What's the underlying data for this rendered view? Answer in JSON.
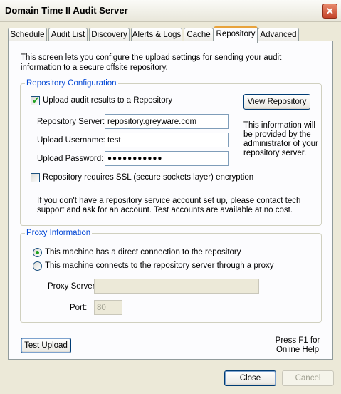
{
  "window": {
    "title": "Domain Time II Audit Server",
    "close_symbol": "✕"
  },
  "tabs": [
    {
      "label": "Schedule"
    },
    {
      "label": "Audit List"
    },
    {
      "label": "Discovery"
    },
    {
      "label": "Alerts & Logs"
    },
    {
      "label": "Cache"
    },
    {
      "label": "Repository",
      "active": true
    },
    {
      "label": "Advanced"
    }
  ],
  "intro_text": "This screen lets you configure the upload settings for sending your audit information to a secure offsite repository.",
  "repo_config": {
    "legend": "Repository Configuration",
    "upload_checkbox": {
      "label": "Upload audit results to a Repository",
      "checked": true
    },
    "view_button": "View Repository",
    "server_label": "Repository Server:",
    "server_value": "repository.greyware.com",
    "username_label": "Upload Username:",
    "username_value": "test",
    "password_label": "Upload Password:",
    "password_value": "●●●●●●●●●●●",
    "info_note": "This information will be provided by the administrator of your repository server.",
    "ssl_checkbox": {
      "label": "Repository requires SSL (secure sockets layer) encryption",
      "checked": false
    },
    "account_note": "If you don't have a repository service account set up, please contact tech support and ask for an account. Test accounts are available at no cost."
  },
  "proxy": {
    "legend": "Proxy Information",
    "direct_radio": {
      "label": "This machine has a direct connection to the repository",
      "selected": true
    },
    "proxy_radio": {
      "label": "This machine connects to the repository server through a proxy",
      "selected": false
    },
    "server_label": "Proxy Server:",
    "server_value": "",
    "port_label": "Port:",
    "port_value": "80"
  },
  "test_upload_button": "Test Upload",
  "help_text": {
    "line1": "Press F1 for",
    "line2": "Online Help"
  },
  "footer": {
    "close_button": "Close",
    "cancel_button": "Cancel"
  },
  "colors": {
    "accent": "#0046D5",
    "tab_highlight": "#E8A33C",
    "check": "#21A121",
    "close": "#C4442A"
  }
}
